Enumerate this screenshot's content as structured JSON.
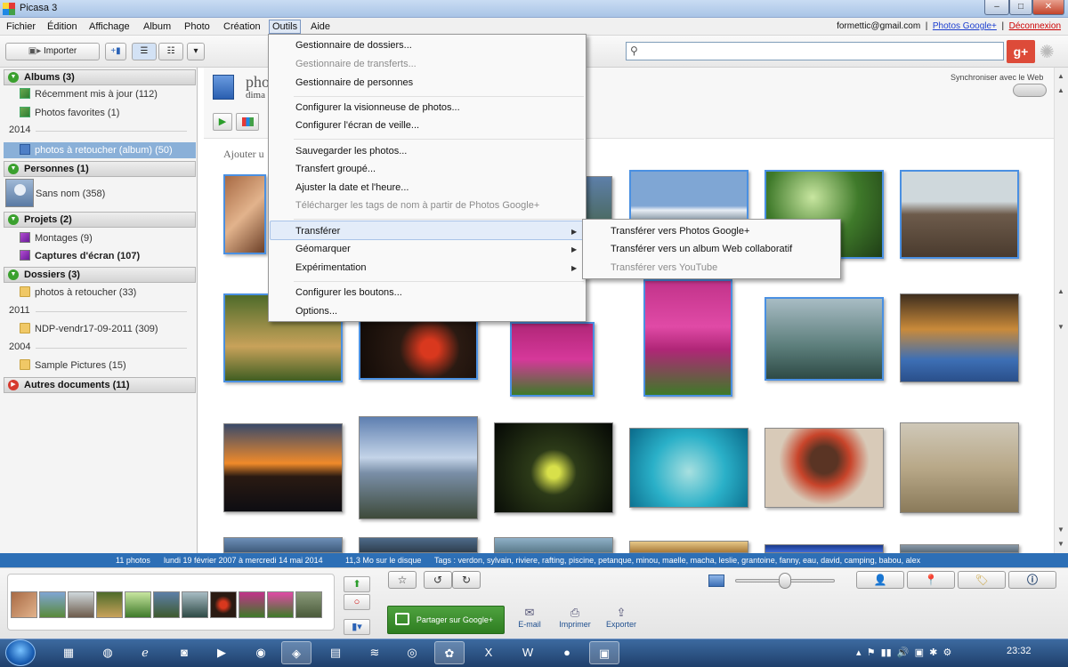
{
  "window": {
    "title": "Picasa 3",
    "min": "–",
    "max": "□",
    "close": "✕"
  },
  "menubar": {
    "items": [
      "Fichier",
      "Édition",
      "Affichage",
      "Album",
      "Photo",
      "Création",
      "Outils",
      "Aide"
    ],
    "account_email": "formettic@gmail.com",
    "sep": "|",
    "photos_link": "Photos Google+",
    "logout": "Déconnexion"
  },
  "toolbar": {
    "import_label": "Importer",
    "search_placeholder": "",
    "gplus_label": "g+"
  },
  "sidebar": {
    "albums": {
      "title": "Albums (3)",
      "items": [
        "Récemment mis à jour (112)",
        "Photos favorites (1)"
      ],
      "year": "2014",
      "selected": "photos à retoucher (album) (50)"
    },
    "people": {
      "title": "Personnes (1)",
      "item": "Sans nom (358)"
    },
    "projects": {
      "title": "Projets (2)",
      "items": [
        "Montages (9)",
        "Captures d'écran (107)"
      ]
    },
    "folders": {
      "title": "Dossiers (3)",
      "items": [
        "photos à retoucher (33)",
        "NDP-vendr17-09-2011 (309)",
        "Sample Pictures (15)"
      ],
      "years": [
        "2011",
        "2004"
      ]
    },
    "other": {
      "title": "Autres documents (11)"
    }
  },
  "main": {
    "album_title": "pho",
    "album_sub": "dima",
    "add_hint": "Ajouter u",
    "sync_label": "Synchroniser avec le Web"
  },
  "outils_menu": {
    "items": [
      {
        "label": "Gestionnaire de dossiers...",
        "disabled": false
      },
      {
        "label": "Gestionnaire de transferts...",
        "disabled": true
      },
      {
        "label": "Gestionnaire de personnes",
        "disabled": false
      },
      {
        "label": "Configurer la visionneuse de photos...",
        "disabled": false
      },
      {
        "label": "Configurer l'écran de veille...",
        "disabled": false
      },
      {
        "label": "Sauvegarder les photos...",
        "disabled": false
      },
      {
        "label": "Transfert groupé...",
        "disabled": false
      },
      {
        "label": "Ajuster la date et l'heure...",
        "disabled": false
      },
      {
        "label": "Télécharger les tags de nom à partir de Photos Google+",
        "disabled": true
      },
      {
        "label": "Transférer",
        "disabled": false,
        "submenu": true
      },
      {
        "label": "Géomarquer",
        "disabled": false,
        "submenu": true
      },
      {
        "label": "Expérimentation",
        "disabled": false,
        "submenu": true
      },
      {
        "label": "Configurer les boutons...",
        "disabled": false
      },
      {
        "label": "Options...",
        "disabled": false
      }
    ]
  },
  "transfer_submenu": {
    "items": [
      {
        "label": "Transférer vers Photos Google+",
        "disabled": false
      },
      {
        "label": "Transférer vers un album Web collaboratif",
        "disabled": false
      },
      {
        "label": "Transférer vers YouTube",
        "disabled": true
      }
    ]
  },
  "statusbar": {
    "count": "11 photos",
    "dates": "lundi 19 février 2007 à mercredi 14 mai 2014",
    "size": "11,3 Mo sur le disque",
    "tags": "Tags : verdon, sylvain, riviere, rafting, piscine, petanque, minou, maelle, macha, leslie, grantoine, fanny, eau, david, camping, babou, alex"
  },
  "tray": {
    "share_label": "Partager sur Google+",
    "email_label": "E-mail",
    "print_label": "Imprimer",
    "export_label": "Exporter"
  },
  "taskbar": {
    "clock": "23:32"
  },
  "colors": {
    "accent": "#2d6fb6",
    "selection": "#8ab0d8",
    "share_green": "#3a8f2d",
    "gplus_red": "#dd4b39"
  }
}
